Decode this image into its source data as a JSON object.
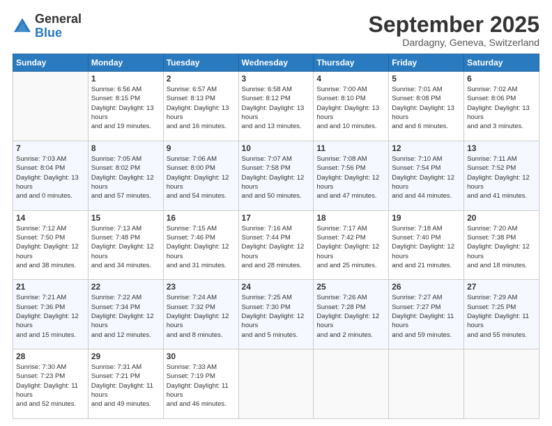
{
  "logo": {
    "general": "General",
    "blue": "Blue"
  },
  "header": {
    "month": "September 2025",
    "location": "Dardagny, Geneva, Switzerland"
  },
  "days_of_week": [
    "Sunday",
    "Monday",
    "Tuesday",
    "Wednesday",
    "Thursday",
    "Friday",
    "Saturday"
  ],
  "weeks": [
    [
      {
        "day": "",
        "sunrise": "",
        "sunset": "",
        "daylight": ""
      },
      {
        "day": "1",
        "sunrise": "Sunrise: 6:56 AM",
        "sunset": "Sunset: 8:15 PM",
        "daylight": "Daylight: 13 hours and 19 minutes."
      },
      {
        "day": "2",
        "sunrise": "Sunrise: 6:57 AM",
        "sunset": "Sunset: 8:13 PM",
        "daylight": "Daylight: 13 hours and 16 minutes."
      },
      {
        "day": "3",
        "sunrise": "Sunrise: 6:58 AM",
        "sunset": "Sunset: 8:12 PM",
        "daylight": "Daylight: 13 hours and 13 minutes."
      },
      {
        "day": "4",
        "sunrise": "Sunrise: 7:00 AM",
        "sunset": "Sunset: 8:10 PM",
        "daylight": "Daylight: 13 hours and 10 minutes."
      },
      {
        "day": "5",
        "sunrise": "Sunrise: 7:01 AM",
        "sunset": "Sunset: 8:08 PM",
        "daylight": "Daylight: 13 hours and 6 minutes."
      },
      {
        "day": "6",
        "sunrise": "Sunrise: 7:02 AM",
        "sunset": "Sunset: 8:06 PM",
        "daylight": "Daylight: 13 hours and 3 minutes."
      }
    ],
    [
      {
        "day": "7",
        "sunrise": "Sunrise: 7:03 AM",
        "sunset": "Sunset: 8:04 PM",
        "daylight": "Daylight: 13 hours and 0 minutes."
      },
      {
        "day": "8",
        "sunrise": "Sunrise: 7:05 AM",
        "sunset": "Sunset: 8:02 PM",
        "daylight": "Daylight: 12 hours and 57 minutes."
      },
      {
        "day": "9",
        "sunrise": "Sunrise: 7:06 AM",
        "sunset": "Sunset: 8:00 PM",
        "daylight": "Daylight: 12 hours and 54 minutes."
      },
      {
        "day": "10",
        "sunrise": "Sunrise: 7:07 AM",
        "sunset": "Sunset: 7:58 PM",
        "daylight": "Daylight: 12 hours and 50 minutes."
      },
      {
        "day": "11",
        "sunrise": "Sunrise: 7:08 AM",
        "sunset": "Sunset: 7:56 PM",
        "daylight": "Daylight: 12 hours and 47 minutes."
      },
      {
        "day": "12",
        "sunrise": "Sunrise: 7:10 AM",
        "sunset": "Sunset: 7:54 PM",
        "daylight": "Daylight: 12 hours and 44 minutes."
      },
      {
        "day": "13",
        "sunrise": "Sunrise: 7:11 AM",
        "sunset": "Sunset: 7:52 PM",
        "daylight": "Daylight: 12 hours and 41 minutes."
      }
    ],
    [
      {
        "day": "14",
        "sunrise": "Sunrise: 7:12 AM",
        "sunset": "Sunset: 7:50 PM",
        "daylight": "Daylight: 12 hours and 38 minutes."
      },
      {
        "day": "15",
        "sunrise": "Sunrise: 7:13 AM",
        "sunset": "Sunset: 7:48 PM",
        "daylight": "Daylight: 12 hours and 34 minutes."
      },
      {
        "day": "16",
        "sunrise": "Sunrise: 7:15 AM",
        "sunset": "Sunset: 7:46 PM",
        "daylight": "Daylight: 12 hours and 31 minutes."
      },
      {
        "day": "17",
        "sunrise": "Sunrise: 7:16 AM",
        "sunset": "Sunset: 7:44 PM",
        "daylight": "Daylight: 12 hours and 28 minutes."
      },
      {
        "day": "18",
        "sunrise": "Sunrise: 7:17 AM",
        "sunset": "Sunset: 7:42 PM",
        "daylight": "Daylight: 12 hours and 25 minutes."
      },
      {
        "day": "19",
        "sunrise": "Sunrise: 7:18 AM",
        "sunset": "Sunset: 7:40 PM",
        "daylight": "Daylight: 12 hours and 21 minutes."
      },
      {
        "day": "20",
        "sunrise": "Sunrise: 7:20 AM",
        "sunset": "Sunset: 7:38 PM",
        "daylight": "Daylight: 12 hours and 18 minutes."
      }
    ],
    [
      {
        "day": "21",
        "sunrise": "Sunrise: 7:21 AM",
        "sunset": "Sunset: 7:36 PM",
        "daylight": "Daylight: 12 hours and 15 minutes."
      },
      {
        "day": "22",
        "sunrise": "Sunrise: 7:22 AM",
        "sunset": "Sunset: 7:34 PM",
        "daylight": "Daylight: 12 hours and 12 minutes."
      },
      {
        "day": "23",
        "sunrise": "Sunrise: 7:24 AM",
        "sunset": "Sunset: 7:32 PM",
        "daylight": "Daylight: 12 hours and 8 minutes."
      },
      {
        "day": "24",
        "sunrise": "Sunrise: 7:25 AM",
        "sunset": "Sunset: 7:30 PM",
        "daylight": "Daylight: 12 hours and 5 minutes."
      },
      {
        "day": "25",
        "sunrise": "Sunrise: 7:26 AM",
        "sunset": "Sunset: 7:28 PM",
        "daylight": "Daylight: 12 hours and 2 minutes."
      },
      {
        "day": "26",
        "sunrise": "Sunrise: 7:27 AM",
        "sunset": "Sunset: 7:27 PM",
        "daylight": "Daylight: 11 hours and 59 minutes."
      },
      {
        "day": "27",
        "sunrise": "Sunrise: 7:29 AM",
        "sunset": "Sunset: 7:25 PM",
        "daylight": "Daylight: 11 hours and 55 minutes."
      }
    ],
    [
      {
        "day": "28",
        "sunrise": "Sunrise: 7:30 AM",
        "sunset": "Sunset: 7:23 PM",
        "daylight": "Daylight: 11 hours and 52 minutes."
      },
      {
        "day": "29",
        "sunrise": "Sunrise: 7:31 AM",
        "sunset": "Sunset: 7:21 PM",
        "daylight": "Daylight: 11 hours and 49 minutes."
      },
      {
        "day": "30",
        "sunrise": "Sunrise: 7:33 AM",
        "sunset": "Sunset: 7:19 PM",
        "daylight": "Daylight: 11 hours and 46 minutes."
      },
      {
        "day": "",
        "sunrise": "",
        "sunset": "",
        "daylight": ""
      },
      {
        "day": "",
        "sunrise": "",
        "sunset": "",
        "daylight": ""
      },
      {
        "day": "",
        "sunrise": "",
        "sunset": "",
        "daylight": ""
      },
      {
        "day": "",
        "sunrise": "",
        "sunset": "",
        "daylight": ""
      }
    ]
  ]
}
